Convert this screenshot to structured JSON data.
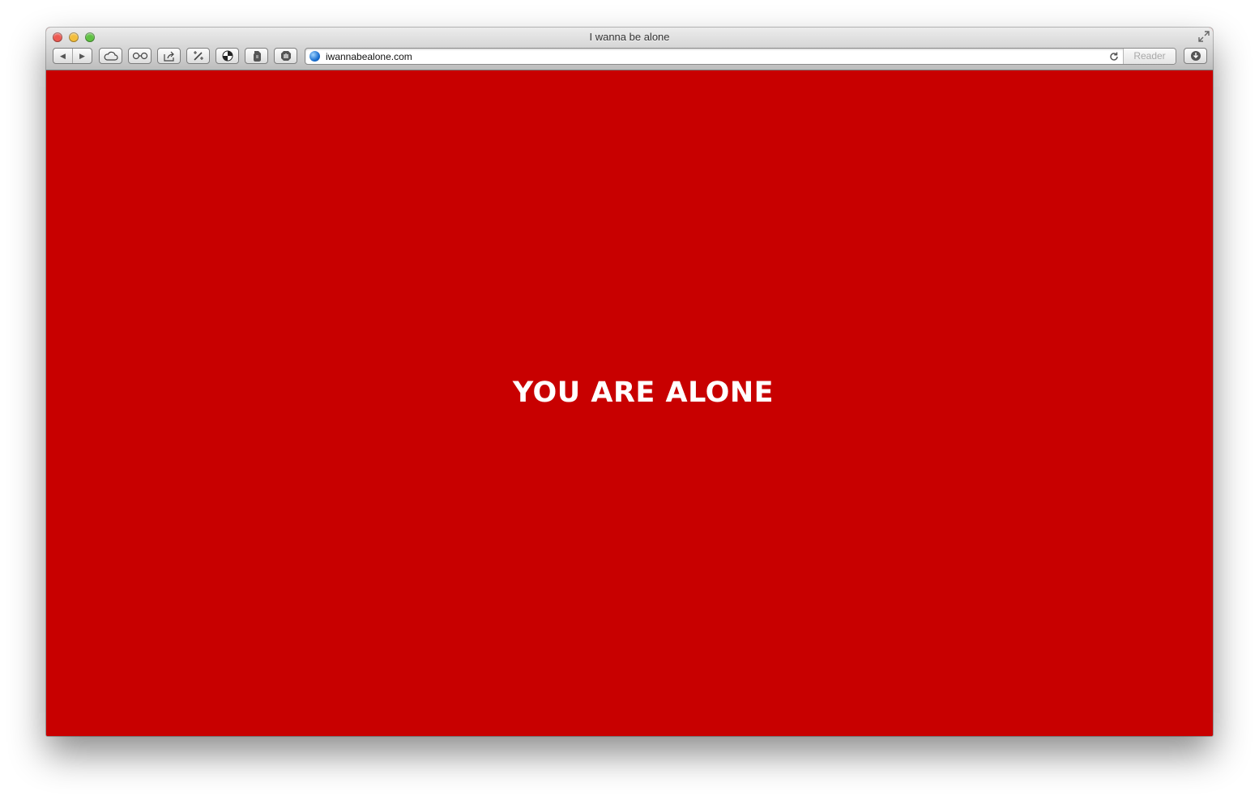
{
  "window": {
    "title": "I wanna be alone",
    "colors": {
      "close": "#ed5a52",
      "minimize": "#f3be3c",
      "zoom": "#5fc142"
    }
  },
  "toolbar": {
    "back_icon": "◀",
    "forward_icon": "▶",
    "buttons": [
      {
        "name": "icloud-tabs-button",
        "icon": "cloud-icon"
      },
      {
        "name": "reading-list-button",
        "icon": "glasses-icon"
      },
      {
        "name": "share-button",
        "icon": "share-icon"
      },
      {
        "name": "extension-button-1",
        "icon": "magic-wand-icon"
      },
      {
        "name": "extension-button-2",
        "icon": "crash-test-icon"
      },
      {
        "name": "evernote-button",
        "icon": "elephant-icon"
      },
      {
        "name": "adblock-button",
        "icon": "hand-stop-icon"
      },
      {
        "name": "downloads-button",
        "icon": "download-icon"
      }
    ]
  },
  "address_bar": {
    "url": "iwannabealone.com",
    "reader_label": "Reader"
  },
  "page": {
    "background": "#c80000",
    "headline": "YOU ARE ALONE"
  }
}
